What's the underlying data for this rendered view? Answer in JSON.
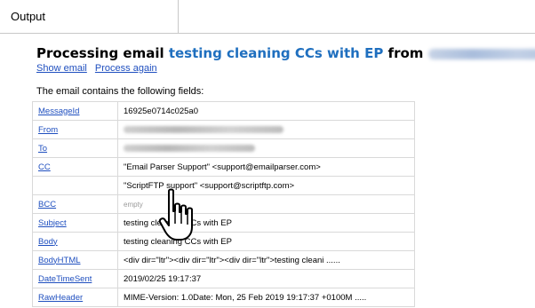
{
  "tab": {
    "label": "Output"
  },
  "heading": {
    "prefix": "Processing email ",
    "subject": "testing cleaning CCs with EP",
    "from_word": " from "
  },
  "actions": {
    "show_email": "Show email",
    "process_again": "Process again"
  },
  "intro": "The email contains the following fields:",
  "fields": [
    {
      "key": "MessageId",
      "value": "16925e0714c025a0"
    },
    {
      "key": "From",
      "value": ""
    },
    {
      "key": "To",
      "value": ""
    },
    {
      "key": "CC",
      "value": "\"Email Parser Support\" <support@emailparser.com>"
    },
    {
      "key": "",
      "value": "\"ScriptFTP support\" <support@scriptftp.com>"
    },
    {
      "key": "BCC",
      "value": "empty"
    },
    {
      "key": "Subject",
      "value": "testing cleaning CCs with EP"
    },
    {
      "key": "Body",
      "value": "testing cleaning CCs with EP"
    },
    {
      "key": "BodyHTML",
      "value": "<div dir=\"ltr\"><div dir=\"ltr\"><div dir=\"ltr\">testing cleani  ......"
    },
    {
      "key": "DateTimeSent",
      "value": "2019/02/25 19:17:37"
    },
    {
      "key": "RawHeader",
      "value": "MIME-Version: 1.0Date: Mon, 25 Feb 2019 19:17:37 +0100M  ....."
    }
  ]
}
